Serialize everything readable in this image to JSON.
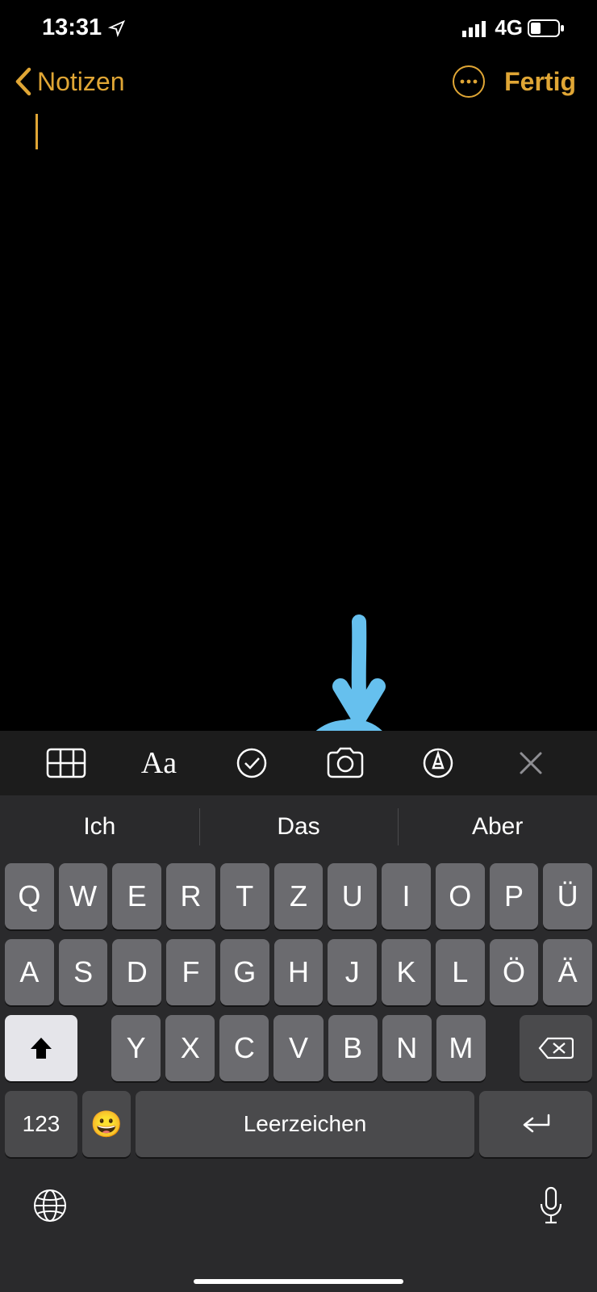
{
  "status": {
    "time": "13:31",
    "network_label": "4G"
  },
  "nav": {
    "back_label": "Notizen",
    "done_label": "Fertig"
  },
  "toolbar": {
    "table_icon": "table-icon",
    "format_icon": "format-icon",
    "checklist_icon": "checklist-icon",
    "camera_icon": "camera-icon",
    "markup_icon": "markup-icon",
    "close_icon": "close-icon"
  },
  "suggestions": [
    "Ich",
    "Das",
    "Aber"
  ],
  "keyboard": {
    "row1": [
      "Q",
      "W",
      "E",
      "R",
      "T",
      "Z",
      "U",
      "I",
      "O",
      "P",
      "Ü"
    ],
    "row2": [
      "A",
      "S",
      "D",
      "F",
      "G",
      "H",
      "J",
      "K",
      "L",
      "Ö",
      "Ä"
    ],
    "row3": [
      "Y",
      "X",
      "C",
      "V",
      "B",
      "N",
      "M"
    ],
    "numbers_label": "123",
    "space_label": "Leerzeichen"
  },
  "annotation": {
    "color": "#66c0ee",
    "target": "camera-button"
  }
}
